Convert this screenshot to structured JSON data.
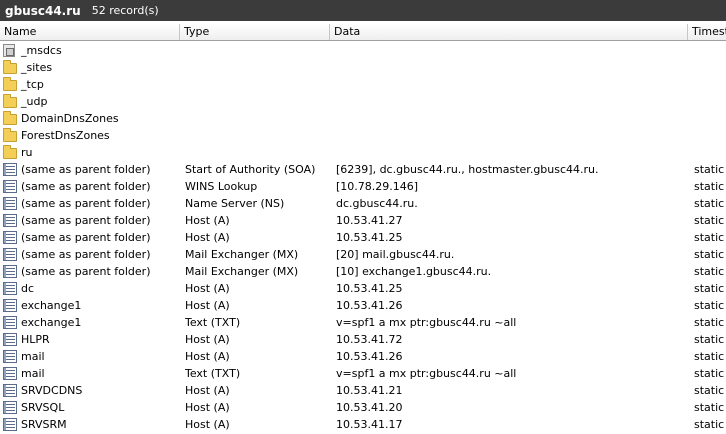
{
  "header": {
    "zone_title": "gbusc44.ru",
    "record_count": "52 record(s)"
  },
  "columns": {
    "name": "Name",
    "type": "Type",
    "data": "Data",
    "timestamp": "Timest"
  },
  "records": [
    {
      "name": "_msdcs",
      "type": "",
      "data": "",
      "timestamp": "",
      "icon": "delegated-folder-icon"
    },
    {
      "name": "_sites",
      "type": "",
      "data": "",
      "timestamp": "",
      "icon": "folder-icon"
    },
    {
      "name": "_tcp",
      "type": "",
      "data": "",
      "timestamp": "",
      "icon": "folder-icon"
    },
    {
      "name": "_udp",
      "type": "",
      "data": "",
      "timestamp": "",
      "icon": "folder-icon"
    },
    {
      "name": "DomainDnsZones",
      "type": "",
      "data": "",
      "timestamp": "",
      "icon": "folder-icon"
    },
    {
      "name": "ForestDnsZones",
      "type": "",
      "data": "",
      "timestamp": "",
      "icon": "folder-icon"
    },
    {
      "name": "ru",
      "type": "",
      "data": "",
      "timestamp": "",
      "icon": "folder-icon"
    },
    {
      "name": "(same as parent folder)",
      "type": "Start of Authority (SOA)",
      "data": "[6239], dc.gbusc44.ru., hostmaster.gbusc44.ru.",
      "timestamp": "static",
      "icon": "record-icon"
    },
    {
      "name": "(same as parent folder)",
      "type": "WINS Lookup",
      "data": "[10.78.29.146]",
      "timestamp": "static",
      "icon": "record-icon"
    },
    {
      "name": "(same as parent folder)",
      "type": "Name Server (NS)",
      "data": "dc.gbusc44.ru.",
      "timestamp": "static",
      "icon": "record-icon"
    },
    {
      "name": "(same as parent folder)",
      "type": "Host (A)",
      "data": "10.53.41.27",
      "timestamp": "static",
      "icon": "record-icon"
    },
    {
      "name": "(same as parent folder)",
      "type": "Host (A)",
      "data": "10.53.41.25",
      "timestamp": "static",
      "icon": "record-icon"
    },
    {
      "name": "(same as parent folder)",
      "type": "Mail Exchanger (MX)",
      "data": "[20]  mail.gbusc44.ru.",
      "timestamp": "static",
      "icon": "record-icon"
    },
    {
      "name": "(same as parent folder)",
      "type": "Mail Exchanger (MX)",
      "data": "[10]  exchange1.gbusc44.ru.",
      "timestamp": "static",
      "icon": "record-icon"
    },
    {
      "name": "dc",
      "type": "Host (A)",
      "data": "10.53.41.25",
      "timestamp": "static",
      "icon": "record-icon"
    },
    {
      "name": "exchange1",
      "type": "Host (A)",
      "data": "10.53.41.26",
      "timestamp": "static",
      "icon": "record-icon"
    },
    {
      "name": "exchange1",
      "type": "Text (TXT)",
      "data": "v=spf1 a mx ptr:gbusc44.ru ~all",
      "timestamp": "static",
      "icon": "record-icon"
    },
    {
      "name": "HLPR",
      "type": "Host (A)",
      "data": "10.53.41.72",
      "timestamp": "static",
      "icon": "record-icon"
    },
    {
      "name": "mail",
      "type": "Host (A)",
      "data": "10.53.41.26",
      "timestamp": "static",
      "icon": "record-icon"
    },
    {
      "name": "mail",
      "type": "Text (TXT)",
      "data": "v=spf1 a mx ptr:gbusc44.ru ~all",
      "timestamp": "static",
      "icon": "record-icon"
    },
    {
      "name": "SRVDCDNS",
      "type": "Host (A)",
      "data": "10.53.41.21",
      "timestamp": "static",
      "icon": "record-icon"
    },
    {
      "name": "SRVSQL",
      "type": "Host (A)",
      "data": "10.53.41.20",
      "timestamp": "static",
      "icon": "record-icon"
    },
    {
      "name": "SRVSRM",
      "type": "Host (A)",
      "data": "10.53.41.17",
      "timestamp": "static",
      "icon": "record-icon"
    }
  ]
}
